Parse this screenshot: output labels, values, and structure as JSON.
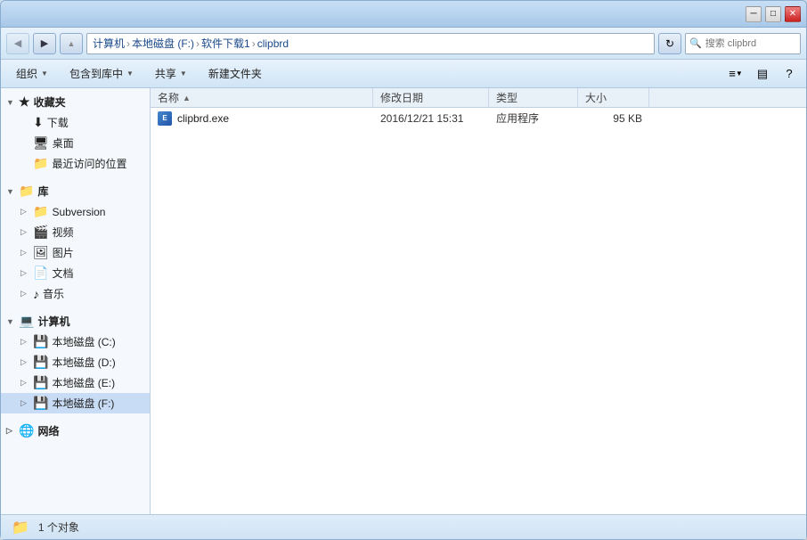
{
  "window": {
    "title": "clipbrd"
  },
  "titlebar": {
    "minimize_label": "─",
    "maximize_label": "□",
    "close_label": "✕"
  },
  "addressbar": {
    "back_icon": "◀",
    "forward_icon": "▶",
    "up_icon": "▲",
    "refresh_icon": "↻",
    "breadcrumb": [
      {
        "label": "计算机"
      },
      {
        "label": "本地磁盘 (F:)"
      },
      {
        "label": "软件下载1"
      },
      {
        "label": "clipbrd"
      }
    ],
    "search_placeholder": "搜索 clipbrd",
    "search_value": ""
  },
  "toolbar": {
    "organize_label": "组织",
    "include_label": "包含到库中",
    "share_label": "共享",
    "new_folder_label": "新建文件夹",
    "view_icon": "≡",
    "pane_icon": "▤",
    "help_icon": "?"
  },
  "sidebar": {
    "favorites": {
      "label": "收藏夹",
      "icon": "★",
      "items": [
        {
          "label": "下载",
          "icon": "⬇",
          "color": "#4488dd"
        },
        {
          "label": "桌面",
          "icon": "🖥"
        },
        {
          "label": "最近访问的位置",
          "icon": "📁"
        }
      ]
    },
    "libraries": {
      "label": "库",
      "icon": "📚",
      "items": [
        {
          "label": "Subversion",
          "icon": "📁"
        },
        {
          "label": "视频",
          "icon": "🎬"
        },
        {
          "label": "图片",
          "icon": "🖼"
        },
        {
          "label": "文档",
          "icon": "📄"
        },
        {
          "label": "音乐",
          "icon": "♪"
        }
      ]
    },
    "computer": {
      "label": "计算机",
      "icon": "💻",
      "items": [
        {
          "label": "本地磁盘 (C:)",
          "icon": "💾"
        },
        {
          "label": "本地磁盘 (D:)",
          "icon": "💾"
        },
        {
          "label": "本地磁盘 (E:)",
          "icon": "💾"
        },
        {
          "label": "本地磁盘 (F:)",
          "icon": "💾",
          "selected": true
        }
      ]
    },
    "network": {
      "label": "网络",
      "icon": "🌐"
    }
  },
  "file_list": {
    "columns": {
      "name": "名称",
      "date": "修改日期",
      "type": "类型",
      "size": "大小"
    },
    "files": [
      {
        "name": "clipbrd.exe",
        "date": "2016/12/21 15:31",
        "type": "应用程序",
        "size": "95 KB",
        "icon": "exe"
      }
    ]
  },
  "statusbar": {
    "count_text": "1 个对象",
    "folder_icon": "📁"
  }
}
